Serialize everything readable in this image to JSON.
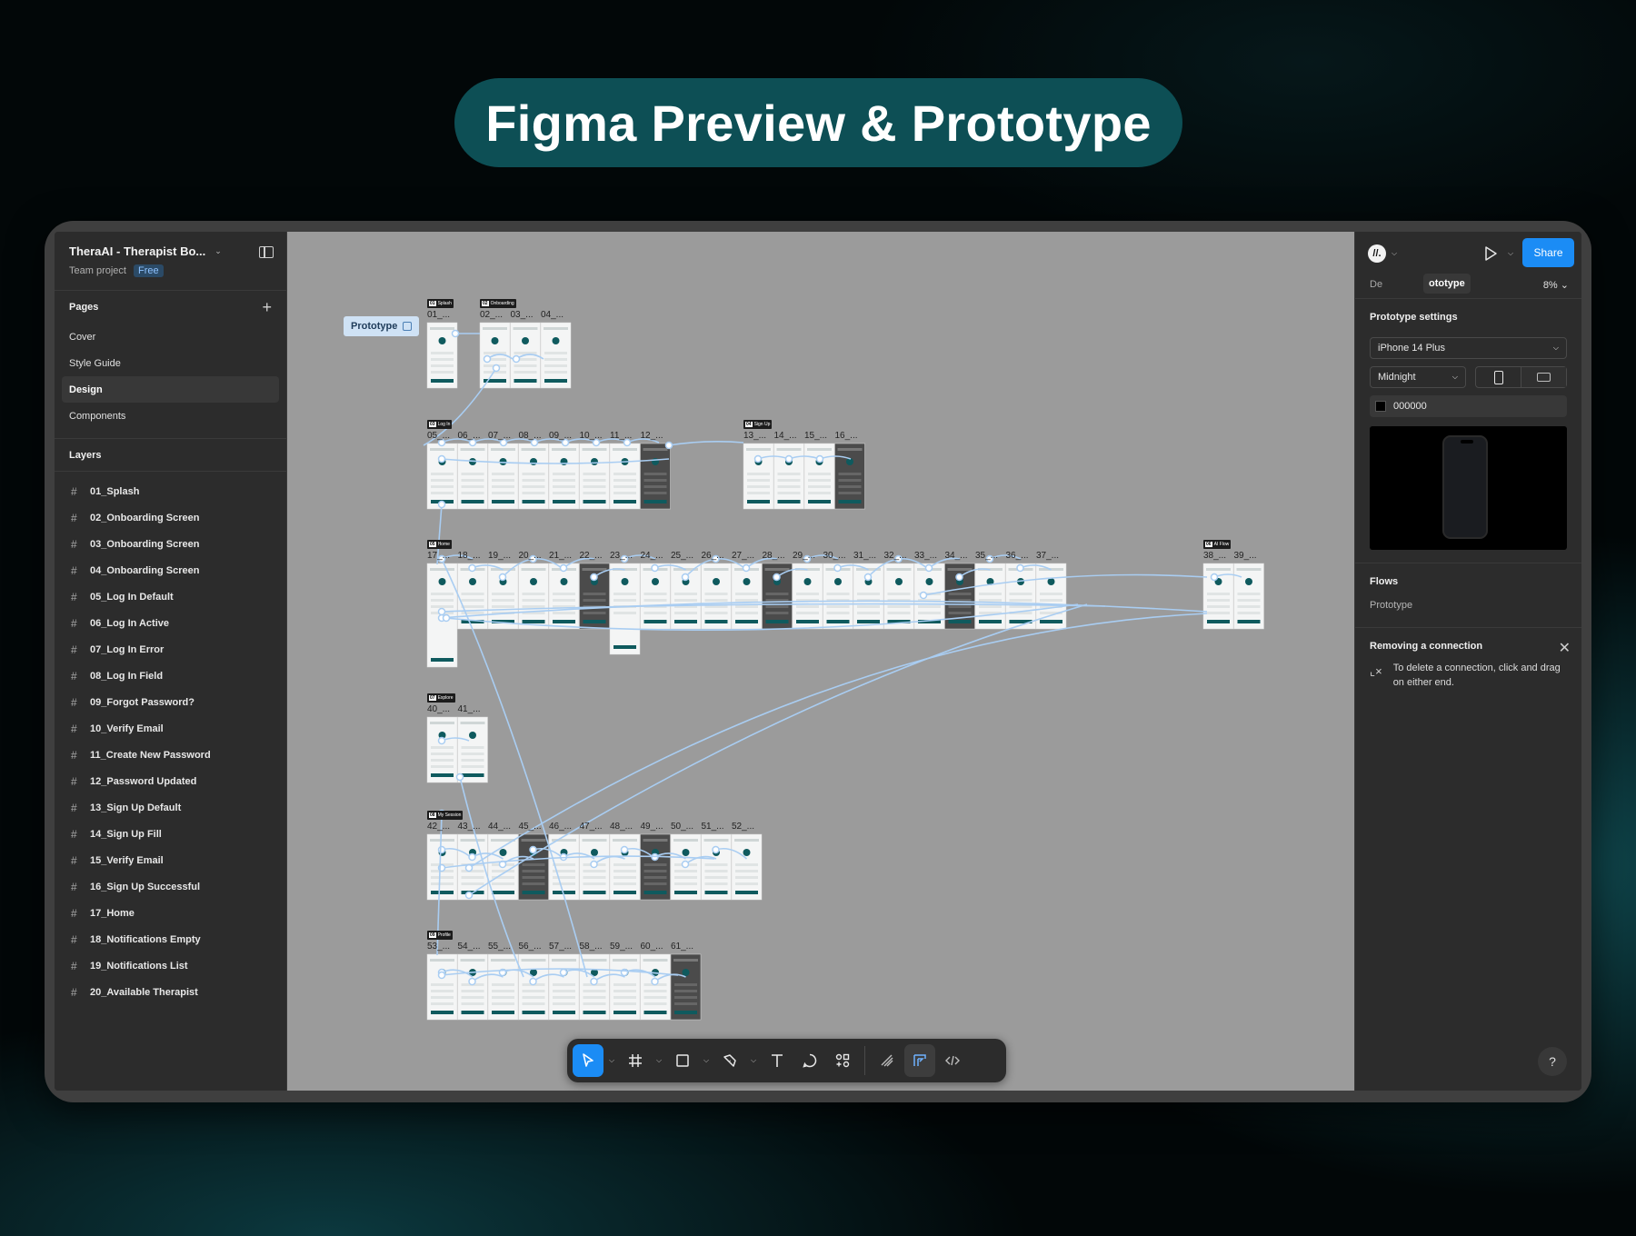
{
  "hero": {
    "title": "Figma Preview & Prototype"
  },
  "file": {
    "name": "TheraAI - Therapist Bo...",
    "team": "Team project",
    "plan_badge": "Free"
  },
  "pages": {
    "heading": "Pages",
    "items": [
      "Cover",
      "Style Guide",
      "Design",
      "Components"
    ],
    "active": "Design"
  },
  "layers": {
    "heading": "Layers",
    "items": [
      "01_Splash",
      "02_Onboarding Screen",
      "03_Onboarding Screen",
      "04_Onboarding Screen",
      "05_Log In Default",
      "06_Log In Active",
      "07_Log In Error",
      "08_Log In Field",
      "09_Forgot Password?",
      "10_Verify Email",
      "11_Create New Password",
      "12_Password Updated",
      "13_Sign Up Default",
      "14_Sign Up Fill",
      "15_Verify Email",
      "16_Sign Up Successful",
      "17_Home",
      "18_Notifications Empty",
      "19_Notifications List",
      "20_Available Therapist"
    ]
  },
  "canvas": {
    "flow_label": "Prototype",
    "rows": [
      {
        "tag": {
          "num": "01",
          "name": "Splash"
        },
        "frames": [
          "01_..."
        ]
      },
      {
        "tag": {
          "num": "02",
          "name": "Onboarding"
        },
        "frames": [
          "02_...",
          "03_...",
          "04_..."
        ]
      },
      {
        "tag": {
          "num": "03",
          "name": "Log In"
        },
        "frames": [
          "05_...",
          "06_...",
          "07_...",
          "08_...",
          "09_...",
          "10_...",
          "11_...",
          "12_..."
        ]
      },
      {
        "tag": {
          "num": "04",
          "name": "Sign Up"
        },
        "frames": [
          "13_...",
          "14_...",
          "15_...",
          "16_..."
        ]
      },
      {
        "tag": {
          "num": "05",
          "name": "Home"
        },
        "frames": [
          "17_...",
          "18_...",
          "19_...",
          "20_...",
          "21_...",
          "22_...",
          "23_...",
          "24_...",
          "25_...",
          "26_...",
          "27_...",
          "28_...",
          "29_...",
          "30_...",
          "31_...",
          "32_...",
          "33_...",
          "34_...",
          "35_...",
          "36_...",
          "37_..."
        ]
      },
      {
        "tag": {
          "num": "06",
          "name": "AI Flow"
        },
        "frames": [
          "38_...",
          "39_..."
        ]
      },
      {
        "tag": {
          "num": "07",
          "name": "Explore"
        },
        "frames": [
          "40_...",
          "41_..."
        ]
      },
      {
        "tag": {
          "num": "08",
          "name": "My Session"
        },
        "frames": [
          "42_...",
          "43_...",
          "44_...",
          "45_...",
          "46_...",
          "47_...",
          "48_...",
          "49_...",
          "50_...",
          "51_...",
          "52_..."
        ]
      },
      {
        "tag": {
          "num": "09",
          "name": "Profile"
        },
        "frames": [
          "53_...",
          "54_...",
          "55_...",
          "56_...",
          "57_...",
          "58_...",
          "59_...",
          "60_...",
          "61_..."
        ]
      }
    ]
  },
  "toolbar": {
    "tools": [
      "move-tool",
      "frame-tool",
      "shape-tool",
      "pen-tool",
      "text-tool",
      "comment-tool",
      "actions-tool",
      "draw-mode",
      "design-mode",
      "dev-mode"
    ]
  },
  "right": {
    "avatar_initial": "//.",
    "share_label": "Share",
    "tab_design": "De",
    "tab_prototype": "ototype",
    "zoom": "8%",
    "settings_heading": "Prototype settings",
    "device": "iPhone 14 Plus",
    "model": "Midnight",
    "background_hex": "000000",
    "flows_heading": "Flows",
    "flow_item": "Prototype",
    "notice_title": "Removing a connection",
    "notice_text": "To delete a connection, click and drag on either end.",
    "help": "?"
  },
  "colors": {
    "accent": "#1b8cf5",
    "hero_pill": "#0d4f55",
    "connection": "#a9cdf2",
    "canvas": "#9b9b9b"
  }
}
